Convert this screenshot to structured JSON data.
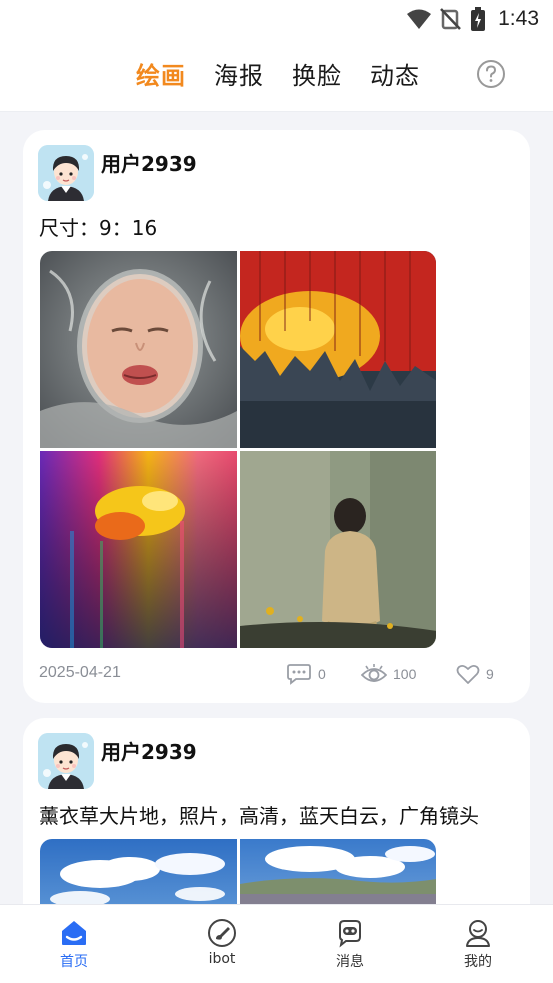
{
  "status_bar": {
    "time": "1:43"
  },
  "top_nav": {
    "tabs": [
      {
        "label": "绘画",
        "active": true
      },
      {
        "label": "海报",
        "active": false
      },
      {
        "label": "换脸",
        "active": false
      },
      {
        "label": "动态",
        "active": false
      }
    ],
    "accent_color": "#f2891e"
  },
  "posts": [
    {
      "username": "用户2939",
      "caption": "尺寸：9：16",
      "date": "2025-04-21",
      "comments": "0",
      "views": "100",
      "likes": "9",
      "images": [
        "woman-face-in-water",
        "red-yellow-paint-wall",
        "rainbow-paint-drip",
        "woman-back-against-wall"
      ]
    },
    {
      "username": "用户2939",
      "caption": "薰衣草大片地，照片，高清，蓝天白云，广角镜头",
      "images": [
        "blue-sky-clouds",
        "lavender-field-sky"
      ]
    }
  ],
  "bottom_nav": {
    "items": [
      {
        "label": "首页",
        "icon": "home-icon",
        "active": true
      },
      {
        "label": "ibot",
        "icon": "brush-icon",
        "active": false
      },
      {
        "label": "消息",
        "icon": "robot-chat-icon",
        "active": false
      },
      {
        "label": "我的",
        "icon": "user-icon",
        "active": false
      }
    ],
    "active_color": "#2a6df4"
  }
}
